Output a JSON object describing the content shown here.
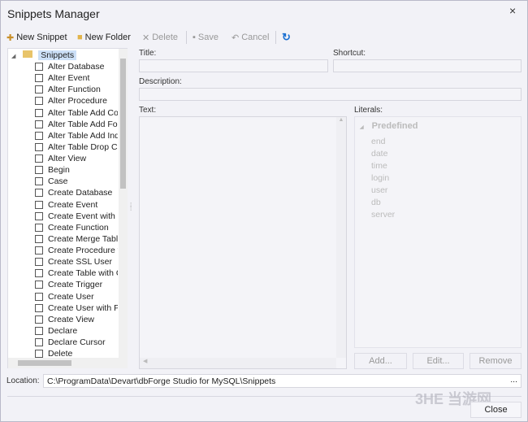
{
  "window": {
    "title": "Snippets Manager",
    "close_icon": "×"
  },
  "toolbar": {
    "new_snippet": "New Snippet",
    "new_folder": "New Folder",
    "delete": "Delete",
    "save": "Save",
    "cancel": "Cancel",
    "refresh_icon": "↻"
  },
  "tree": {
    "root": "Snippets",
    "items": [
      "Alter Database",
      "Alter Event",
      "Alter Function",
      "Alter Procedure",
      "Alter Table Add Column",
      "Alter Table Add Foreign Key",
      "Alter Table Add Index",
      "Alter Table Drop Column",
      "Alter View",
      "Begin",
      "Case",
      "Create Database",
      "Create Event",
      "Create Event with Interval",
      "Create Function",
      "Create Merge Table",
      "Create Procedure with",
      "Create SSL User",
      "Create Table with Options",
      "Create Trigger",
      "Create User",
      "Create User with Privileges",
      "Create View",
      "Declare",
      "Declare Cursor",
      "Delete"
    ]
  },
  "form": {
    "title_label": "Title:",
    "shortcut_label": "Shortcut:",
    "description_label": "Description:",
    "text_label": "Text:",
    "literals_label": "Literals:"
  },
  "literals": {
    "group": "Predefined",
    "items": [
      "end",
      "date",
      "time",
      "login",
      "user",
      "db",
      "server"
    ]
  },
  "buttons": {
    "add": "Add...",
    "edit": "Edit...",
    "remove": "Remove",
    "close": "Close",
    "browse": "..."
  },
  "location": {
    "label": "Location:",
    "value": "C:\\ProgramData\\Devart\\dbForge Studio for MySQL\\Snippets"
  },
  "watermark": "3HE 当游网"
}
